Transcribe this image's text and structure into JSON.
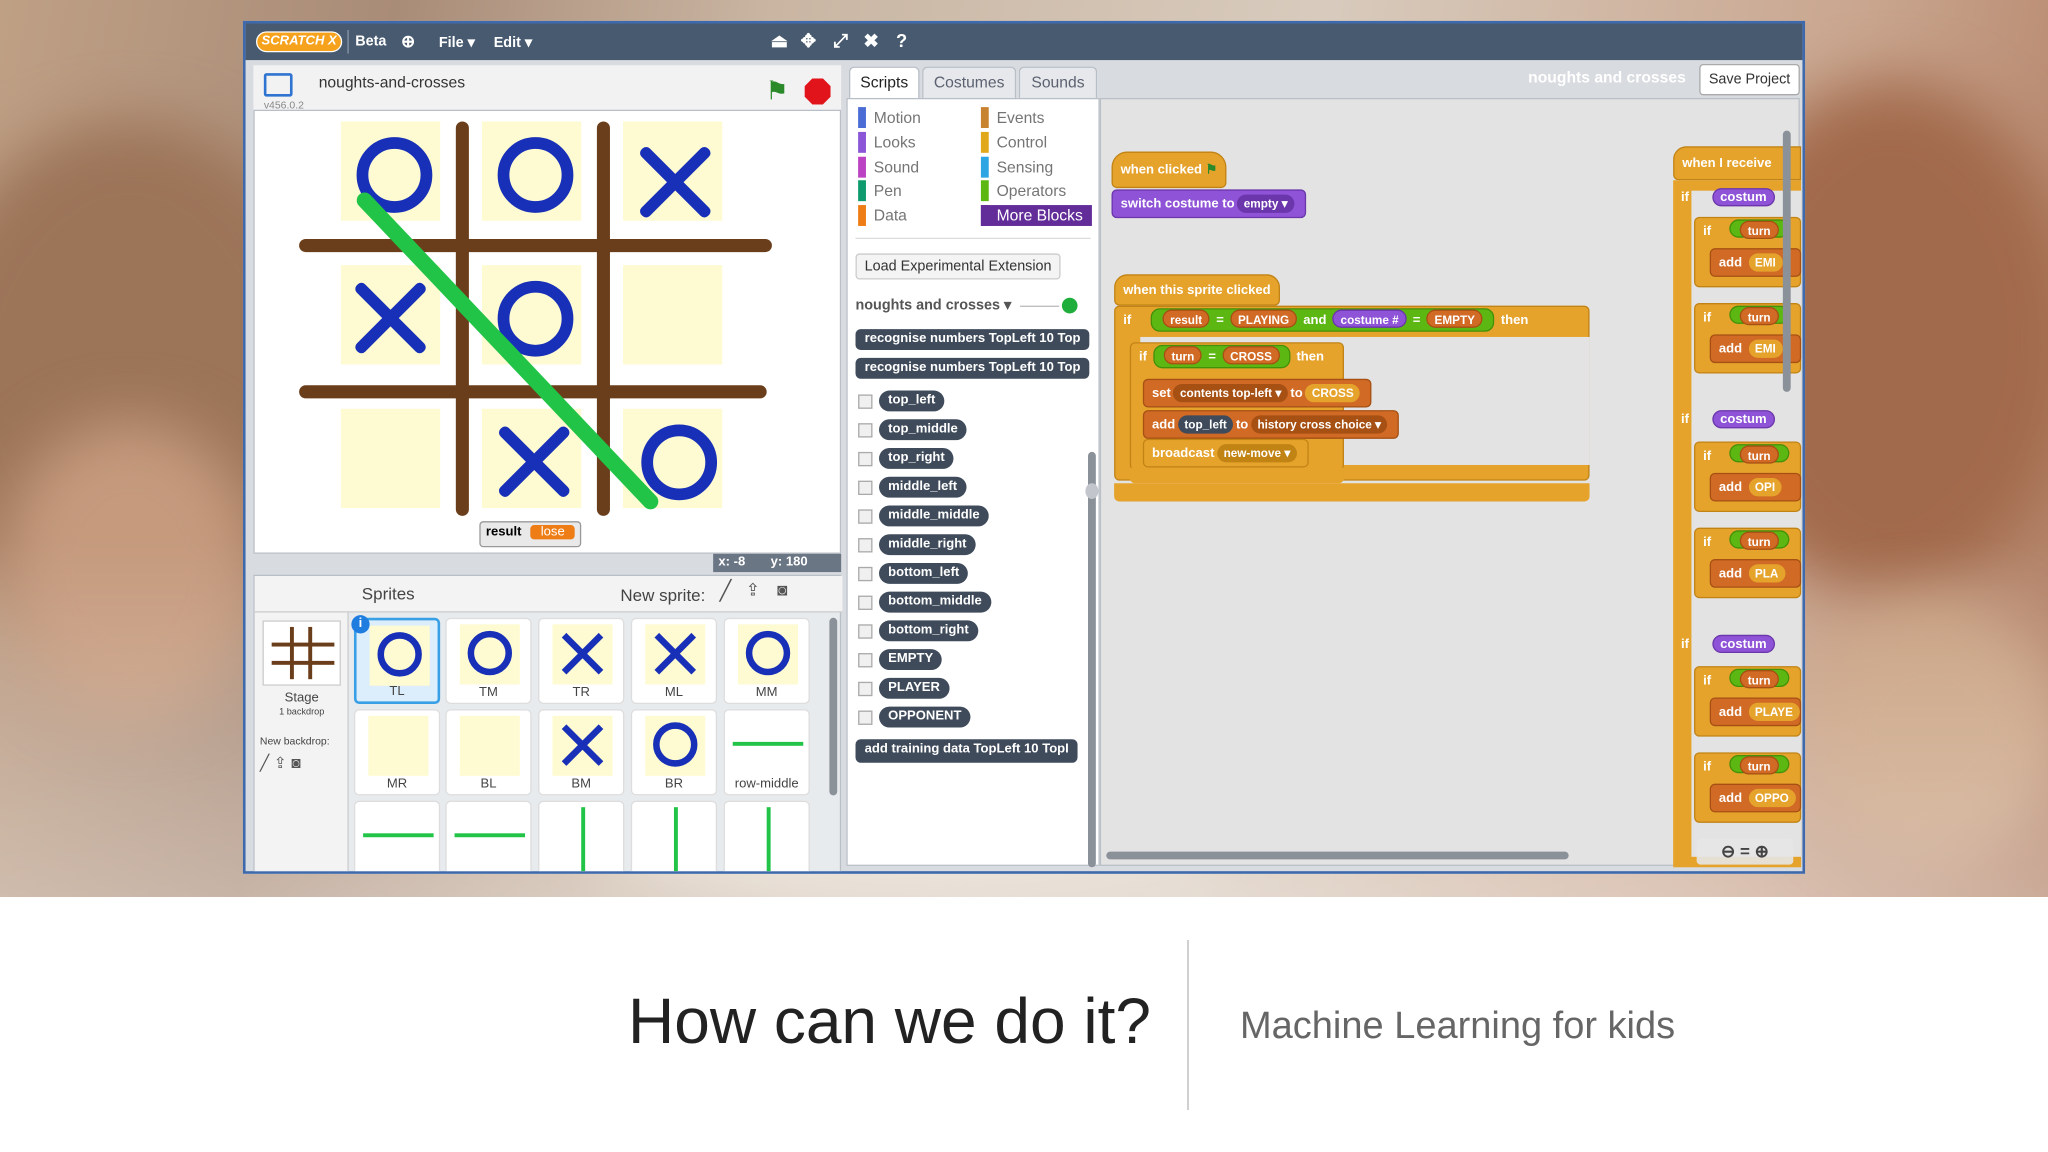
{
  "app": {
    "logo": "SCRATCH X",
    "beta": "Beta",
    "file_menu": "File ▾",
    "edit_menu": "Edit ▾",
    "project_title": "noughts and crosses",
    "save_button": "Save Project"
  },
  "stage": {
    "project_name": "noughts-and-crosses",
    "version": "v456.0.2",
    "result_label": "result",
    "result_value": "lose",
    "x_readout": "x: -8",
    "y_readout": "y: 180"
  },
  "tabs": [
    "Scripts",
    "Costumes",
    "Sounds"
  ],
  "categories_left": [
    "Motion",
    "Looks",
    "Sound",
    "Pen",
    "Data"
  ],
  "categories_right": [
    "Events",
    "Control",
    "Sensing",
    "Operators",
    "More Blocks"
  ],
  "category_colors": {
    "Motion": "#4a6cd4",
    "Looks": "#8a55d7",
    "Sound": "#bb42c3",
    "Pen": "#0e9a6c",
    "Data": "#ee7d16",
    "Events": "#c88330",
    "Control": "#e1a91a",
    "Sensing": "#2ca5e2",
    "Operators": "#5cb712",
    "More Blocks": "#632d99"
  },
  "palette": {
    "experimental": "Load Experimental Extension",
    "extension_name": "noughts and crosses ▾",
    "blocks": [
      "recognise numbers TopLeft 10 Top",
      "recognise numbers TopLeft 10 Top"
    ],
    "vars": [
      "top_left",
      "top_middle",
      "top_right",
      "middle_left",
      "middle_middle",
      "middle_right",
      "bottom_left",
      "bottom_middle",
      "bottom_right",
      "EMPTY",
      "PLAYER",
      "OPPONENT"
    ],
    "training": "add training data TopLeft 10 TopI"
  },
  "script1": {
    "hat": "when clicked",
    "body": "switch costume to",
    "arg": "empty ▾"
  },
  "script2": {
    "hat": "when this sprite clicked",
    "if": "if",
    "result": "result",
    "eq": "=",
    "playing": "PLAYING",
    "and": "and",
    "costume": "costume #",
    "empty": "EMPTY",
    "then": "then",
    "turn": "turn",
    "cross": "CROSS",
    "set": "set",
    "contents": "contents top-left ▾",
    "to": "to",
    "add": "add",
    "top_left": "top_left",
    "history": "history cross choice ▾",
    "broadcast": "broadcast",
    "new_move": "new-move ▾"
  },
  "script3": {
    "hat": "when I receive",
    "if": "if",
    "costume": "costum",
    "turn": "turn",
    "add": "add",
    "a1": "EMI",
    "a2": "EMI",
    "a3": "OPI",
    "a4": "PLA",
    "a5": "PLAYE",
    "a6": "OPPO"
  },
  "sprites": {
    "header": "Sprites",
    "new_sprite": "New sprite:",
    "stage_label": "Stage",
    "stage_sub": "1 backdrop",
    "new_backdrop": "New backdrop:",
    "items": [
      "TL",
      "TM",
      "TR",
      "ML",
      "MM",
      "MR",
      "BL",
      "BM",
      "BR",
      "row-middle"
    ]
  },
  "slide": {
    "title": "How can we do it?",
    "subtitle": "Machine Learning for kids"
  }
}
